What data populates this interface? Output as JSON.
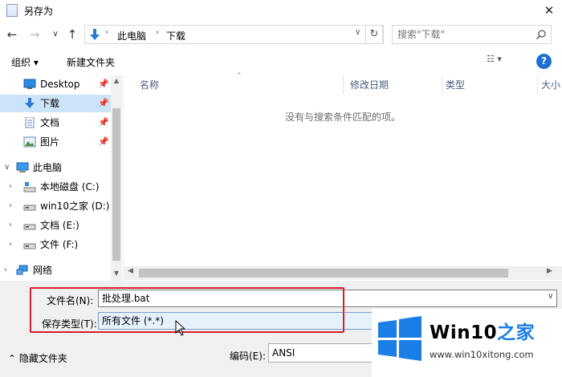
{
  "window": {
    "title": "另存为",
    "close": "✕"
  },
  "address": {
    "path": [
      "此电脑",
      "下载"
    ],
    "separator": "›",
    "dropdown": "∨",
    "refresh": "↻"
  },
  "nav_buttons": {
    "back": "←",
    "forward": "→",
    "recent": "∨",
    "up": "↑"
  },
  "search": {
    "placeholder": "搜索\"下载\""
  },
  "toolbar": {
    "organize": "组织 ▾",
    "new_folder": "新建文件夹",
    "view": "☷ ▾",
    "help": "?"
  },
  "nav_pane": {
    "items": [
      {
        "label": "Desktop",
        "pinned": true
      },
      {
        "label": "下载",
        "pinned": true,
        "selected": true
      },
      {
        "label": "文档",
        "pinned": true
      },
      {
        "label": "图片",
        "pinned": true
      },
      {
        "label": "此电脑",
        "expanded": true
      },
      {
        "label": "本地磁盘 (C:)"
      },
      {
        "label": "win10之家 (D:)"
      },
      {
        "label": "文档 (E:)"
      },
      {
        "label": "文件 (F:)"
      },
      {
        "label": "网络"
      }
    ],
    "pin_glyph": "📌",
    "expanded_glyph": "∨",
    "collapsed_glyph": "›"
  },
  "file_list": {
    "columns": [
      "名称",
      "修改日期",
      "类型",
      "大小"
    ],
    "empty_message": "没有与搜索条件匹配的项。",
    "sort_glyph": "⌃"
  },
  "form": {
    "filename_label": "文件名(N):",
    "filename_value": "批处理.bat",
    "filetype_label": "保存类型(T):",
    "filetype_value": "所有文件  (*.*)",
    "hide_folders": "⌃  隐藏文件夹",
    "encoding_label": "编码(E):",
    "encoding_value": "ANSI"
  },
  "watermark": {
    "title_latin": "Win10",
    "title_zh": "之家",
    "url": "www.win10xitong.com"
  },
  "colors": {
    "accent": "#1a7ee6",
    "selection": "#cce4f7",
    "highlight_box": "#d4202b"
  }
}
